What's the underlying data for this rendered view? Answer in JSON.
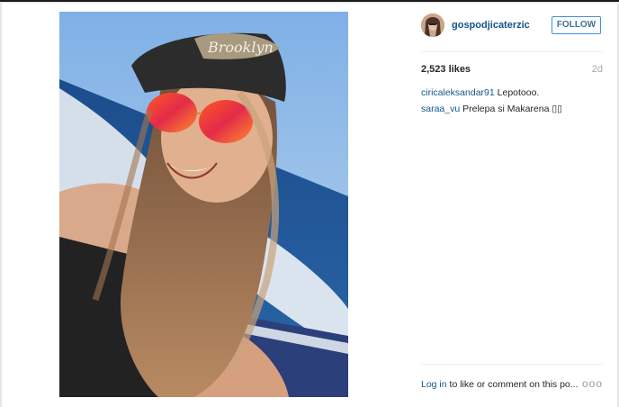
{
  "post": {
    "username": "gospodjicaterzic",
    "follow_label": "FOLLOW",
    "likes": "2,523 likes",
    "age": "2d",
    "comments": [
      {
        "author": "ciricaleksandar91",
        "text": "Lepotooo."
      },
      {
        "author": "saraa_vu",
        "text": "Prelepa si Makarena ▯▯"
      }
    ],
    "footer": {
      "login_link": "Log in",
      "login_text": " to like or comment on this po...",
      "more_label": "ooo"
    }
  },
  "photo": {
    "cap_text": "Brooklyn"
  },
  "colors": {
    "link": "#125688",
    "follow_border": "#4090db",
    "sky": "#9cc3ea",
    "sea": "#1f4f8a"
  },
  "icons": {
    "more": "more-options-icon"
  }
}
